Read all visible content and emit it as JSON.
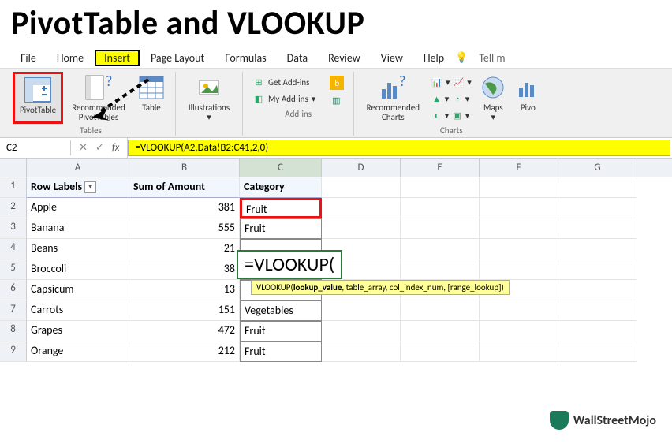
{
  "title": "PivotTable and VLOOKUP",
  "menu": {
    "file": "File",
    "home": "Home",
    "insert": "Insert",
    "pagelayout": "Page Layout",
    "formulas": "Formulas",
    "data": "Data",
    "review": "Review",
    "view": "View",
    "help": "Help",
    "tell": "Tell m"
  },
  "ribbon": {
    "pivot": "PivotTable",
    "recpivot": "Recommended PivotTables",
    "table": "Table",
    "illus": "Illustrations",
    "getadd": "Get Add-ins",
    "myadd": "My Add-ins",
    "recchart": "Recommended Charts",
    "maps": "Maps",
    "pivc": "Pivo",
    "grp_tables": "Tables",
    "grp_addins": "Add-ins",
    "grp_charts": "Charts"
  },
  "formula": {
    "name": "C2",
    "value": "=VLOOKUP(A2,Data!B2:C41,2,0)"
  },
  "cols": [
    "A",
    "B",
    "C",
    "D",
    "E",
    "F",
    "G"
  ],
  "headers": {
    "a": "Row Labels",
    "b": "Sum of Amount",
    "c": "Category"
  },
  "rows": [
    {
      "n": "2",
      "a": "Apple",
      "b": "381",
      "c": "Fruit"
    },
    {
      "n": "3",
      "a": "Banana",
      "b": "555",
      "c": "Fruit"
    },
    {
      "n": "4",
      "a": "Beans",
      "b": "21",
      "c": ""
    },
    {
      "n": "5",
      "a": "Broccoli",
      "b": "38",
      "c": ""
    },
    {
      "n": "6",
      "a": "Capsicum",
      "b": "13",
      "c": ""
    },
    {
      "n": "7",
      "a": "Carrots",
      "b": "151",
      "c": "Vegetables"
    },
    {
      "n": "8",
      "a": "Grapes",
      "b": "472",
      "c": "Fruit"
    },
    {
      "n": "9",
      "a": "Orange",
      "b": "212",
      "c": "Fruit"
    }
  ],
  "float": {
    "formula": "=VLOOKUP(",
    "tip_fn": "VLOOKUP(",
    "tip_b": "lookup_value",
    "tip_rest": ", table_array, col_index_num, [range_lookup])"
  },
  "brand": "WallStreetMojo"
}
